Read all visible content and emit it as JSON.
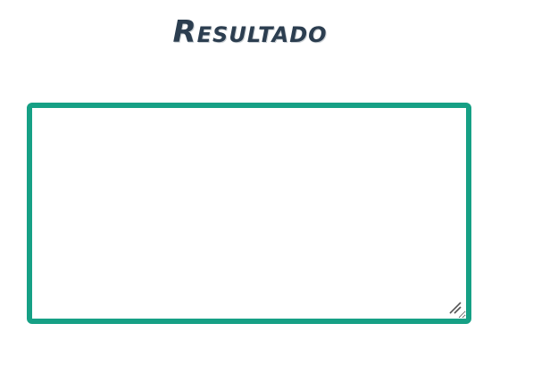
{
  "header": {
    "title": "Resultado"
  },
  "result": {
    "value": "",
    "placeholder": ""
  },
  "colors": {
    "title": "#2c3e50",
    "accent": "#16a085",
    "background": "#ffffff"
  },
  "icons": {
    "resize": "resize-grip-icon"
  }
}
